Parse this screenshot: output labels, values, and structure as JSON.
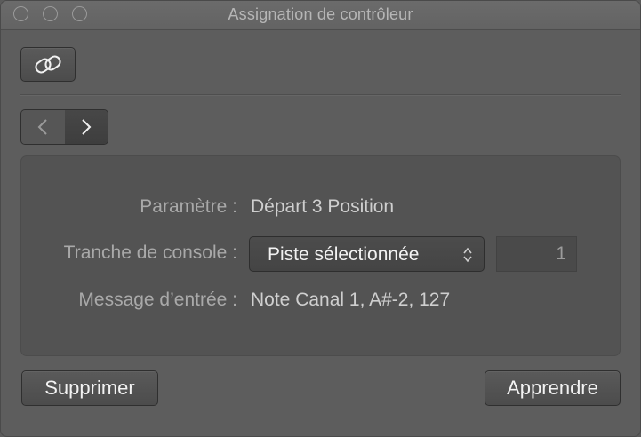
{
  "window": {
    "title": "Assignation de contrôleur"
  },
  "toolbar": {
    "link_icon": "link-icon",
    "prev_icon": "chevron-left-icon",
    "next_icon": "chevron-right-icon"
  },
  "panel": {
    "parameter_label": "Paramètre :",
    "parameter_value": "Départ 3 Position",
    "channel_strip_label": "Tranche de console :",
    "channel_strip_selected": "Piste sélectionnée",
    "channel_strip_number": "1",
    "input_message_label": "Message d’entrée :",
    "input_message_value": "Note Canal 1, A#-2, 127"
  },
  "buttons": {
    "delete_label": "Supprimer",
    "learn_label": "Apprendre"
  }
}
